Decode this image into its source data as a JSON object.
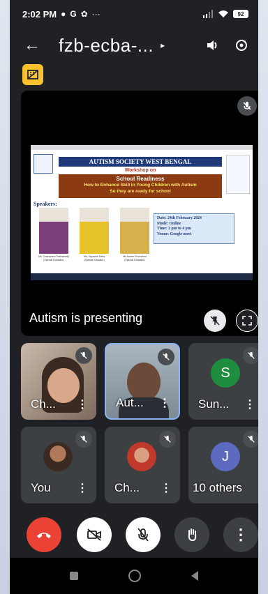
{
  "status": {
    "time": "2:02 PM",
    "icons": [
      "chat-icon",
      "google-icon",
      "fan-icon",
      "more-icon"
    ],
    "battery": "92"
  },
  "appbar": {
    "title": "fzb-ecba-...",
    "caret": "▸"
  },
  "slide": {
    "org": "AUTISM SOCIETY WEST BENGAL",
    "workshop": "Workshop on",
    "topic": "School Readiness",
    "subtitle1": "How to Enhance Skill in Young Children with Autism",
    "subtitle2": "So they are ready for school",
    "speakers_heading": "Speakers:",
    "speakers": [
      {
        "name": "Ms. Chandrani Chakraborty",
        "role": "(Special Educator)"
      },
      {
        "name": "Ms. Priyanka Saha",
        "role": "(Special Educator)"
      },
      {
        "name": "Ms Asima Chowdhuri",
        "role": "(Special Educator)"
      }
    ],
    "date": "Date: 24th February 2024",
    "mode": "Mode: Online",
    "time": "Time: 2 pm to 4 pm",
    "venue": "Venue: Google meet"
  },
  "presenting": "Autism  is presenting",
  "participants": [
    {
      "label": "Ch...",
      "type": "video"
    },
    {
      "label": "Aut...",
      "type": "video"
    },
    {
      "label": "Sun...",
      "initial": "S",
      "type": "avatar",
      "color": "#1e8e3e"
    },
    {
      "label": "You",
      "type": "photo"
    },
    {
      "label": "Ch...",
      "type": "photo"
    },
    {
      "label": "10 others",
      "initial": "J",
      "type": "avatar",
      "color": "#5c6bc0"
    }
  ],
  "colors": {
    "end_call": "#ea4335",
    "highlight": "#8ab4f8",
    "background": "#202124"
  }
}
